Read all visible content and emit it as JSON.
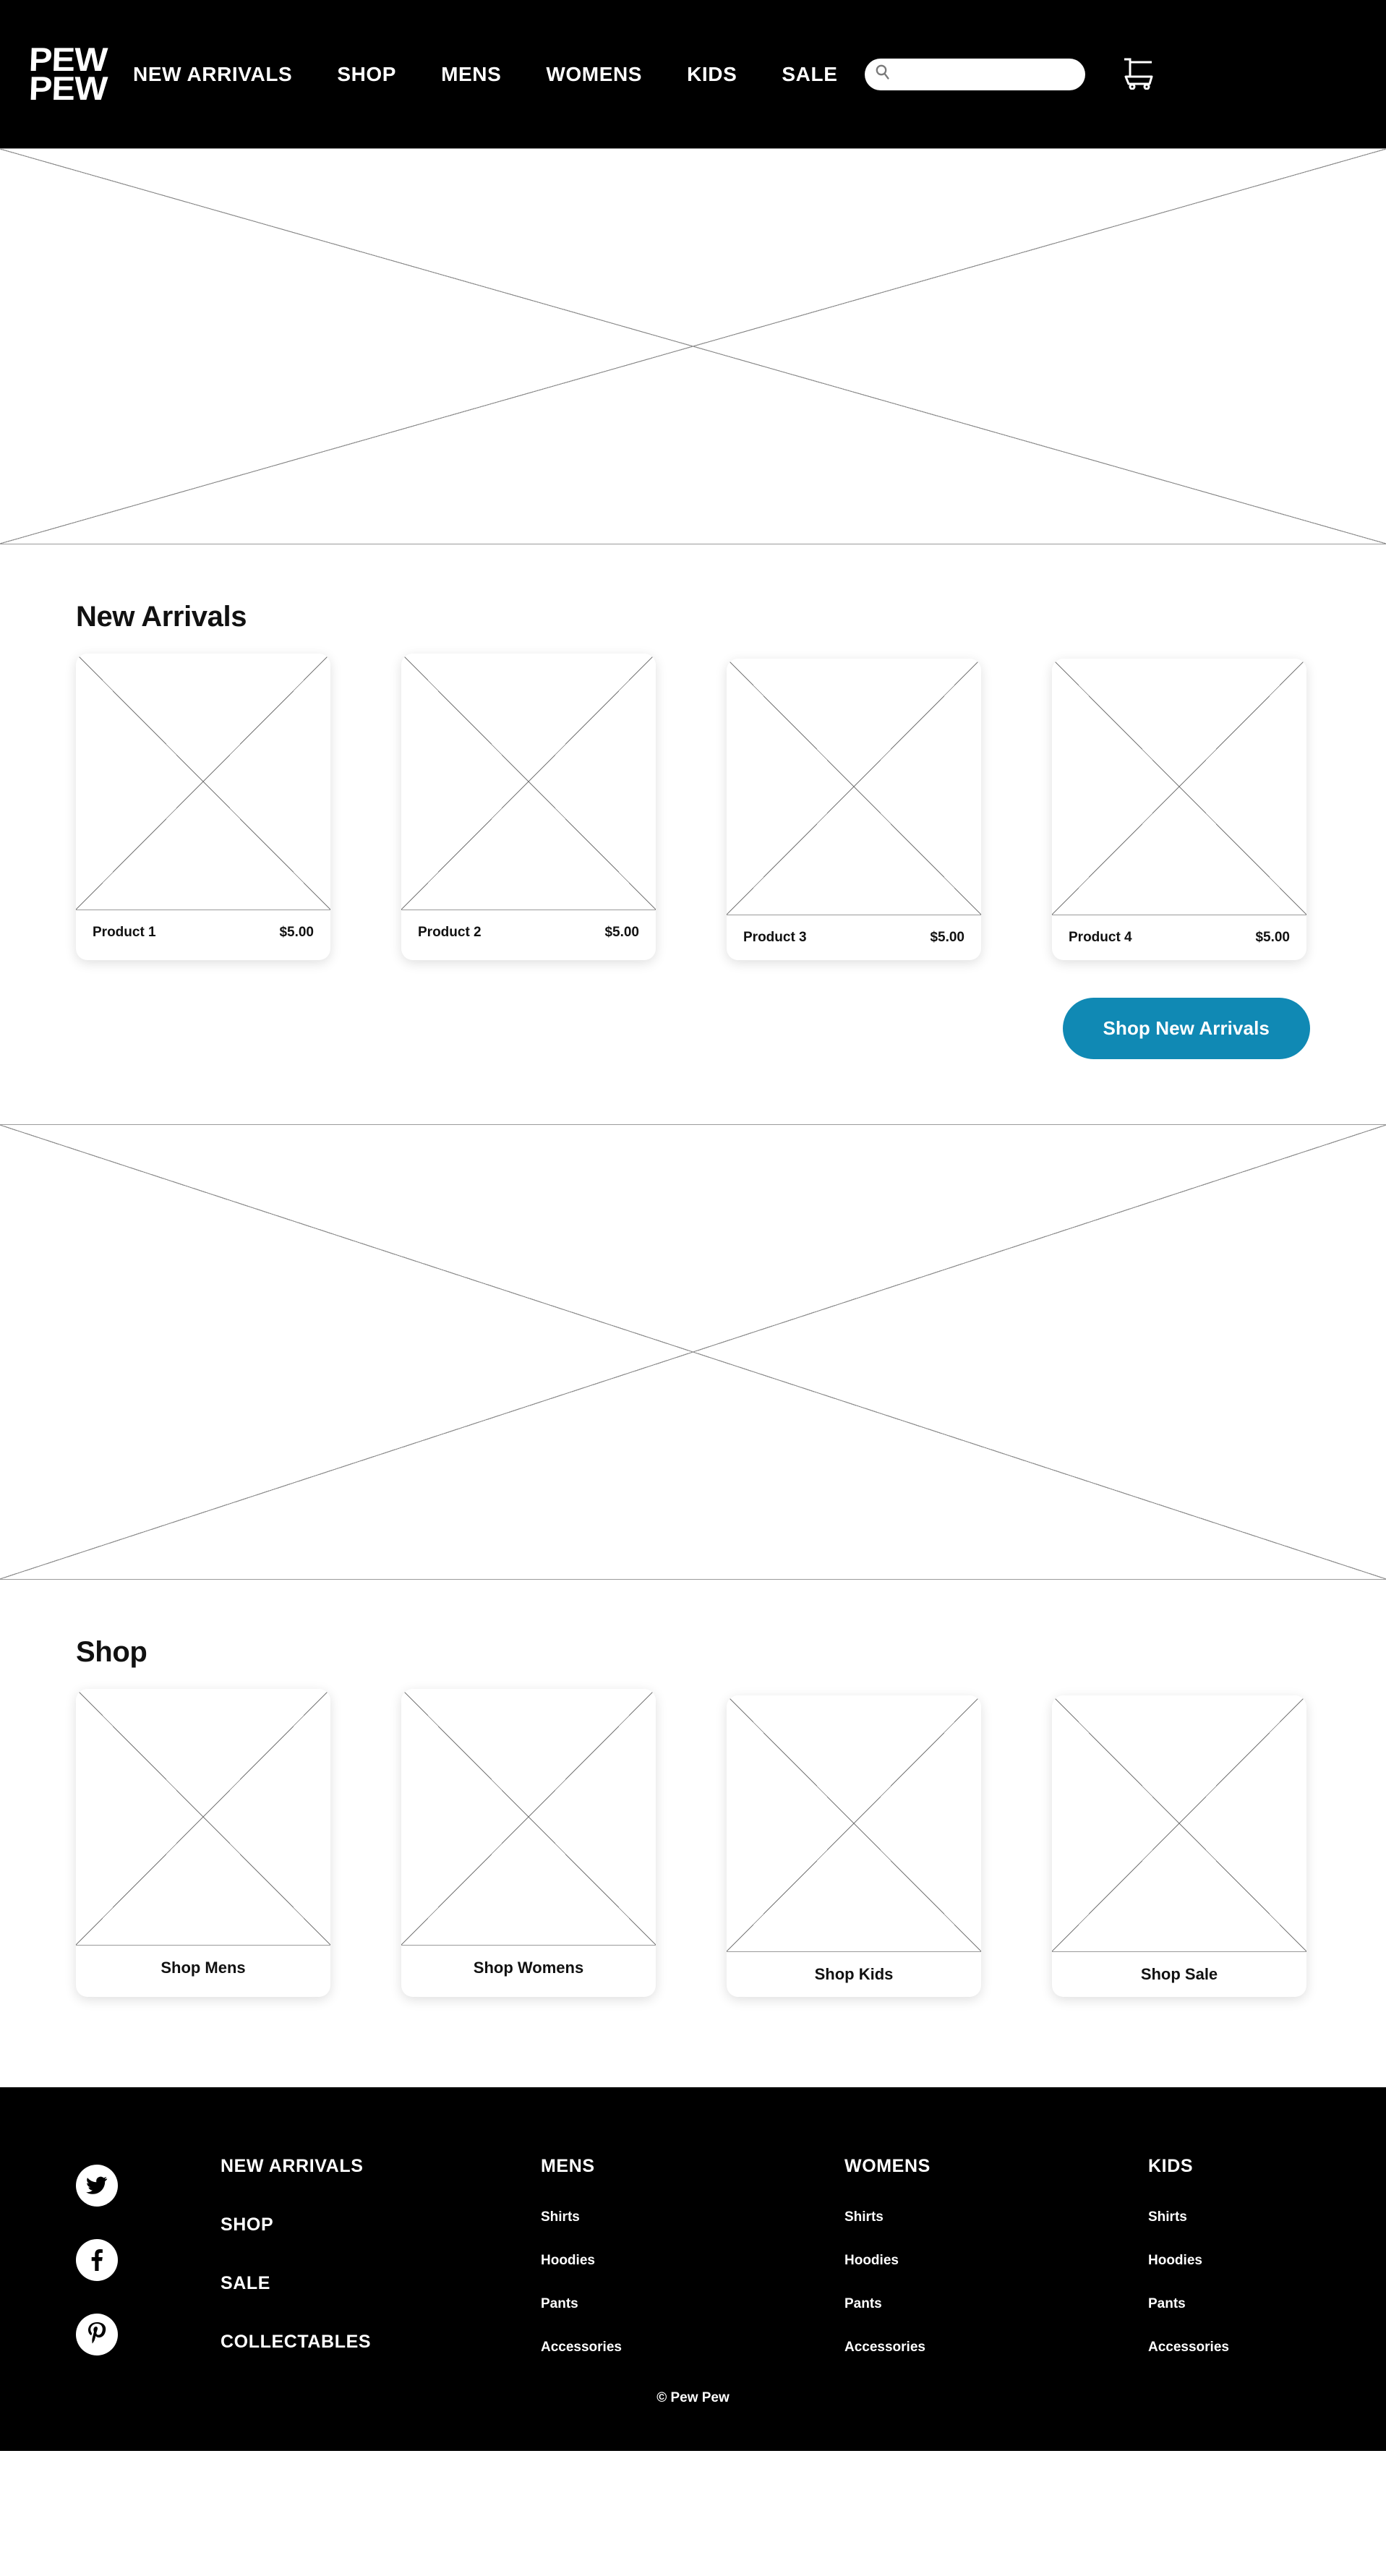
{
  "header": {
    "logo_line1": "PEW",
    "logo_line2": "PEW",
    "nav": [
      {
        "label": "NEW ARRIVALS"
      },
      {
        "label": "SHOP"
      },
      {
        "label": "MENS"
      },
      {
        "label": "WOMENS"
      },
      {
        "label": "KIDS"
      },
      {
        "label": "SALE"
      }
    ],
    "search": {
      "value": "",
      "placeholder": ""
    },
    "cart_icon": "shopping-cart-icon",
    "search_icon": "search-icon"
  },
  "hero_banner": {
    "alt": "broken-image-placeholder"
  },
  "new_arrivals": {
    "title": "New Arrivals",
    "products": [
      {
        "name": "Product 1",
        "price": "$5.00"
      },
      {
        "name": "Product 2",
        "price": "$5.00"
      },
      {
        "name": "Product 3",
        "price": "$5.00"
      },
      {
        "name": "Product 4",
        "price": "$5.00"
      }
    ],
    "cta_label": "Shop New Arrivals",
    "cta_color": "#1089b4"
  },
  "secondary_banner": {
    "alt": "broken-image-placeholder"
  },
  "shop": {
    "title": "Shop",
    "categories": [
      {
        "label": "Shop Mens"
      },
      {
        "label": "Shop Womens"
      },
      {
        "label": "Shop Kids"
      },
      {
        "label": "Shop Sale"
      }
    ]
  },
  "footer": {
    "social": [
      {
        "name": "twitter-icon"
      },
      {
        "name": "facebook-icon"
      },
      {
        "name": "pinterest-icon"
      }
    ],
    "main_links": [
      {
        "label": "NEW ARRIVALS"
      },
      {
        "label": "SHOP"
      },
      {
        "label": "SALE"
      },
      {
        "label": "COLLECTABLES"
      }
    ],
    "columns": [
      {
        "heading": "MENS",
        "links": [
          {
            "label": "Shirts"
          },
          {
            "label": "Hoodies"
          },
          {
            "label": "Pants"
          },
          {
            "label": "Accessories"
          }
        ]
      },
      {
        "heading": "WOMENS",
        "links": [
          {
            "label": "Shirts"
          },
          {
            "label": "Hoodies"
          },
          {
            "label": "Pants"
          },
          {
            "label": "Accessories"
          }
        ]
      },
      {
        "heading": "KIDS",
        "links": [
          {
            "label": "Shirts"
          },
          {
            "label": "Hoodies"
          },
          {
            "label": "Pants"
          },
          {
            "label": "Accessories"
          }
        ]
      }
    ],
    "copyright": "© Pew Pew"
  }
}
